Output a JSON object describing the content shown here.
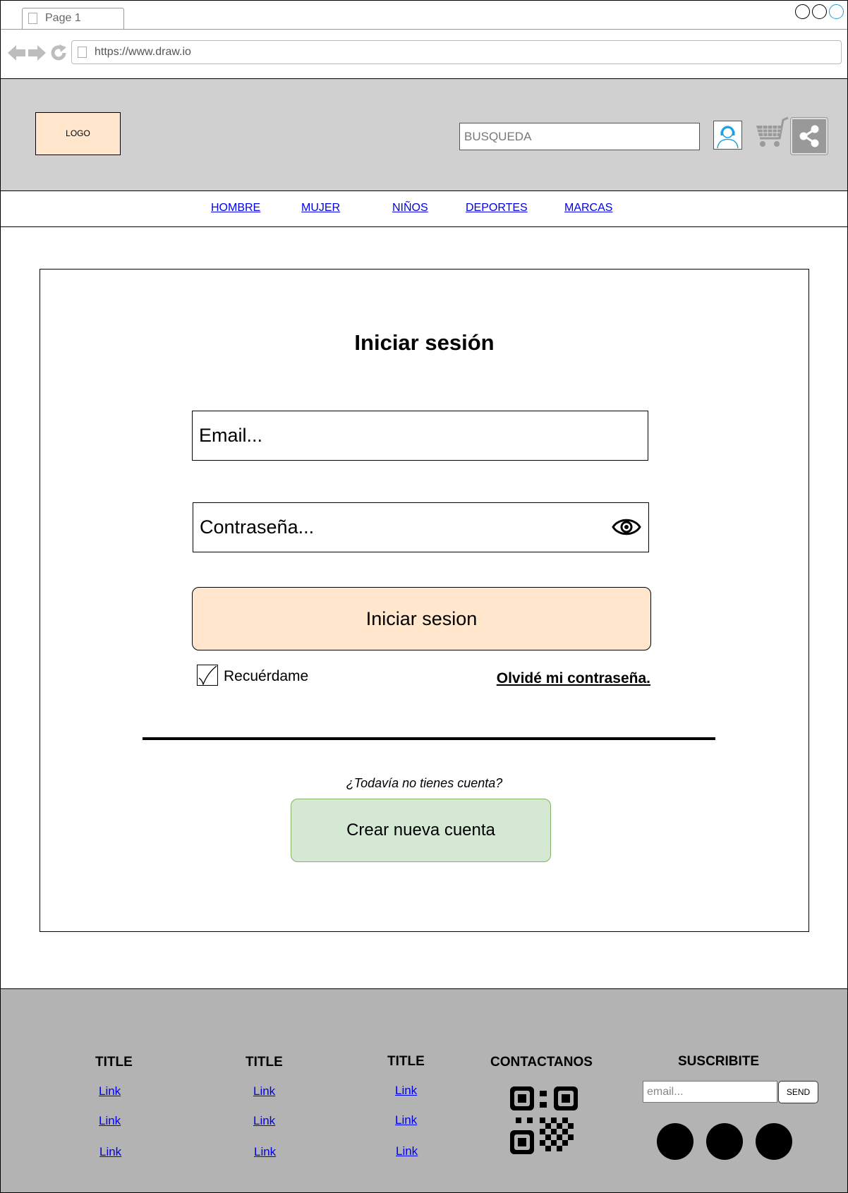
{
  "browser": {
    "tab_label": "Page 1",
    "url": "https://www.draw.io"
  },
  "header": {
    "logo": "LOGO",
    "search_placeholder": "BUSQUEDA"
  },
  "nav": {
    "items": [
      "HOMBRE",
      "MUJER",
      "NIÑOS",
      "DEPORTES",
      "MARCAS"
    ]
  },
  "login": {
    "title": "Iniciar sesión",
    "email_placeholder": "Email...",
    "password_placeholder": "Contraseña...",
    "submit_label": "Iniciar sesion",
    "remember_label": "Recuérdame",
    "forgot_label": "Olvidé mi contraseña.",
    "no_account_text": "¿Todavía no tienes cuenta?",
    "create_label": "Crear nueva cuenta"
  },
  "footer": {
    "columns": [
      {
        "title": "TITLE",
        "links": [
          "Link",
          "Link",
          "Link"
        ]
      },
      {
        "title": "TITLE",
        "links": [
          "Link",
          "Link",
          "Link"
        ]
      },
      {
        "title": "TITLE",
        "links": [
          "Link",
          "Link",
          "Link"
        ]
      }
    ],
    "contact_title": "CONTACTANOS",
    "subscribe_title": "SUSCRIBITE",
    "email_placeholder": "email...",
    "send_label": "SEND"
  }
}
